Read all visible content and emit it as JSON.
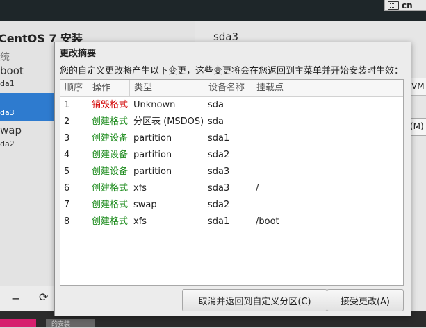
{
  "background": {
    "installer_title": "CentOS 7 安装",
    "left_items": [
      "统",
      "boot",
      "da1",
      "da3",
      "wap",
      "da2"
    ],
    "right_title": "sda3",
    "right_snippets": [
      "VM",
      "(M)"
    ],
    "keyboard_layout": "cn",
    "bottom_bar_label": "的安装"
  },
  "dialog": {
    "title": "更改摘要",
    "description": "您的自定义更改将产生以下变更，这些变更将会在您返回到主菜单并开始安装时生效：",
    "columns": [
      "顺序",
      "操作",
      "类型",
      "设备名称",
      "挂载点"
    ],
    "rows": [
      {
        "order": "1",
        "action": "销毁格式",
        "action_color": "#d20000",
        "type": "Unknown",
        "device": "sda",
        "mount": ""
      },
      {
        "order": "2",
        "action": "创建格式",
        "action_color": "#1a8a1a",
        "type": "分区表 (MSDOS)",
        "device": "sda",
        "mount": ""
      },
      {
        "order": "3",
        "action": "创建设备",
        "action_color": "#1a8a1a",
        "type": "partition",
        "device": "sda1",
        "mount": ""
      },
      {
        "order": "4",
        "action": "创建设备",
        "action_color": "#1a8a1a",
        "type": "partition",
        "device": "sda2",
        "mount": ""
      },
      {
        "order": "5",
        "action": "创建设备",
        "action_color": "#1a8a1a",
        "type": "partition",
        "device": "sda3",
        "mount": ""
      },
      {
        "order": "6",
        "action": "创建格式",
        "action_color": "#1a8a1a",
        "type": "xfs",
        "device": "sda3",
        "mount": "/"
      },
      {
        "order": "7",
        "action": "创建格式",
        "action_color": "#1a8a1a",
        "type": "swap",
        "device": "sda2",
        "mount": ""
      },
      {
        "order": "8",
        "action": "创建格式",
        "action_color": "#1a8a1a",
        "type": "xfs",
        "device": "sda1",
        "mount": "/boot"
      }
    ],
    "cancel_label": "取消并返回到自定义分区(C)",
    "accept_label": "接受更改(A)"
  }
}
